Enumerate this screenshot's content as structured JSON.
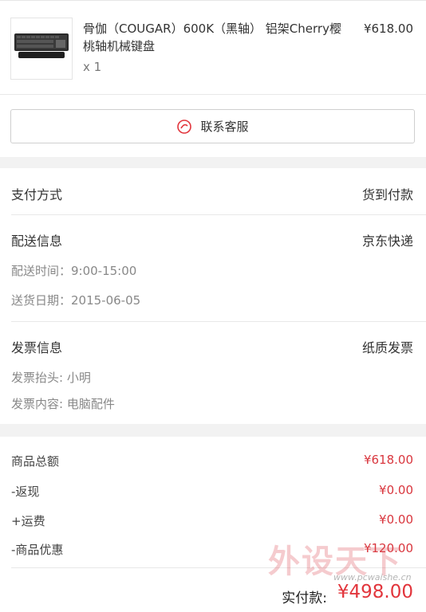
{
  "product": {
    "name": "骨伽（COUGAR）600K（黑轴） 铝架Cherry樱桃轴机械键盘",
    "quantity": "x 1",
    "price": "¥618.00",
    "thumbnail_icon": "keyboard-icon"
  },
  "customer_service": {
    "label": "联系客服",
    "icon": "chat-icon",
    "icon_color": "#e2353c"
  },
  "payment": {
    "label": "支付方式",
    "value": "货到付款"
  },
  "delivery": {
    "label": "配送信息",
    "value": "京东快递",
    "time": "配送时间：9:00-15:00",
    "date": "送货日期：2015-06-05"
  },
  "invoice": {
    "label": "发票信息",
    "value": "纸质发票",
    "title": "发票抬头: 小明",
    "content": "发票内容: 电脑配件"
  },
  "totals": {
    "subtotal_label": "商品总额",
    "subtotal_value": "¥618.00",
    "cashback_label": "-返现",
    "cashback_value": "¥0.00",
    "shipping_label": "+运费",
    "shipping_value": "¥0.00",
    "discount_label": "-商品优惠",
    "discount_value": "¥120.00",
    "final_label": "实付款:",
    "final_value": "¥498.00",
    "accent_color": "#d9363e"
  },
  "watermark": {
    "text": "外设天下",
    "url": "www.pcwaishe.cn"
  }
}
